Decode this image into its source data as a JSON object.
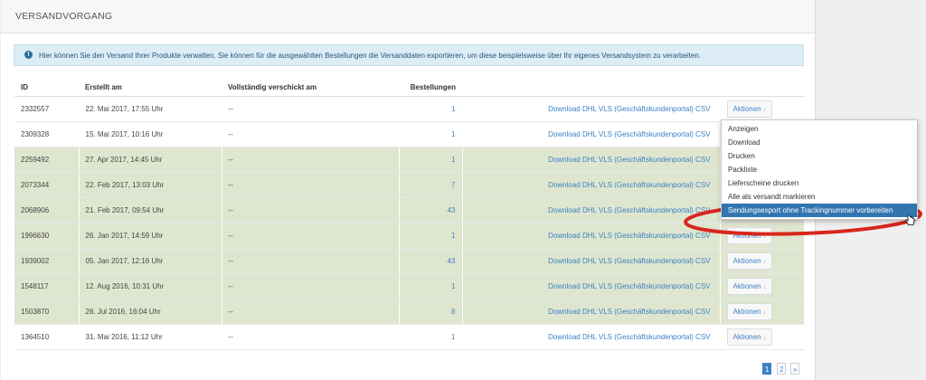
{
  "panel": {
    "title": "VERSANDVORGANG"
  },
  "info": {
    "icon": "info-icon",
    "text": "Hier können Sie den Versand Ihrer Produkte verwalten. Sie können für die ausgewählten Bestellungen die Versanddaten exportieren, um diese beispielsweise über Ihr eigenes Versandsystem zu verarbeiten."
  },
  "table": {
    "headers": [
      "ID",
      "Erstellt am",
      "Vollständig verschickt am",
      "Bestellungen",
      "",
      ""
    ],
    "rows": [
      {
        "id": "2332557",
        "created": "22. Mai 2017, 17:55 Uhr",
        "shipped": "--",
        "orders": "1",
        "download": "Download DHL VLS (Geschäftskundenportal) CSV",
        "action": "Aktionen",
        "caret": "↓",
        "shaded": false
      },
      {
        "id": "2309328",
        "created": "15. Mai 2017, 10:16 Uhr",
        "shipped": "--",
        "orders": "1",
        "download": "Download DHL VLS (Geschäftskundenportal) CSV",
        "action": "",
        "caret": "",
        "shaded": false
      },
      {
        "id": "2259492",
        "created": "27. Apr 2017, 14:45 Uhr",
        "shipped": "--",
        "orders": "1",
        "download": "Download DHL VLS (Geschäftskundenportal) CSV",
        "action": "",
        "caret": "",
        "shaded": true
      },
      {
        "id": "2073344",
        "created": "22. Feb 2017, 13:03 Uhr",
        "shipped": "--",
        "orders": "7",
        "download": "Download DHL VLS (Geschäftskundenportal) CSV",
        "action": "",
        "caret": "",
        "shaded": true
      },
      {
        "id": "2068906",
        "created": "21. Feb 2017, 09:54 Uhr",
        "shipped": "--",
        "orders": "43",
        "download": "Download DHL VLS (Geschäftskundenportal) CSV",
        "action": "",
        "caret": "",
        "shaded": true
      },
      {
        "id": "1996630",
        "created": "26. Jan 2017, 14:59 Uhr",
        "shipped": "--",
        "orders": "1",
        "download": "Download DHL VLS (Geschäftskundenportal) CSV",
        "action": "Aktionen",
        "caret": "↓",
        "shaded": true
      },
      {
        "id": "1939002",
        "created": "05. Jan 2017, 12:16 Uhr",
        "shipped": "--",
        "orders": "43",
        "download": "Download DHL VLS (Geschäftskundenportal) CSV",
        "action": "Aktionen",
        "caret": "↓",
        "shaded": true
      },
      {
        "id": "1548117",
        "created": "12. Aug 2016, 10:31 Uhr",
        "shipped": "--",
        "orders": "1",
        "download": "Download DHL VLS (Geschäftskundenportal) CSV",
        "action": "Aktionen",
        "caret": "↓",
        "shaded": true
      },
      {
        "id": "1503870",
        "created": "26. Jul 2016, 16:04 Uhr",
        "shipped": "--",
        "orders": "8",
        "download": "Download DHL VLS (Geschäftskundenportal) CSV",
        "action": "Aktionen",
        "caret": "↓",
        "shaded": true
      },
      {
        "id": "1364510",
        "created": "31. Mai 2016, 11:12 Uhr",
        "shipped": "--",
        "orders": "1",
        "download": "Download DHL VLS (Geschäftskundenportal) CSV",
        "action": "Aktionen",
        "caret": "↓",
        "shaded": false
      }
    ]
  },
  "dropdown": {
    "items": [
      "Anzeigen",
      "Download",
      "Drucken",
      "Packliste",
      "Lieferscheine drucken",
      "Alle als versandt markieren",
      "Sendungsexport ohne Trackingnummer vorbereiten"
    ],
    "active_index": 6
  },
  "pagination": {
    "pages": [
      "1",
      "2"
    ],
    "next": "»",
    "current": "1"
  },
  "colors": {
    "link": "#3b82c4",
    "shaded_row": "#dfe6cf",
    "highlight": "#3276b1",
    "annotation": "#d9261c"
  }
}
